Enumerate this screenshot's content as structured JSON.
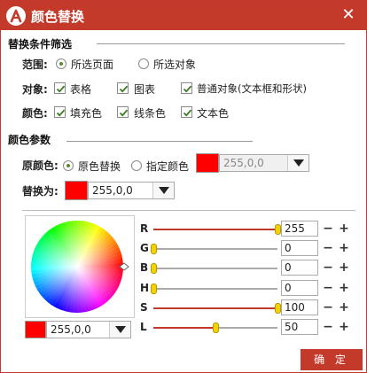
{
  "window": {
    "title": "颜色替换",
    "logo_icon": "app-logo-icon",
    "close_glyph": "✕"
  },
  "filter": {
    "title": "替换条件筛选",
    "scope_label": "范围:",
    "scope_options": [
      {
        "label": "所选页面",
        "selected": true
      },
      {
        "label": "所选对象",
        "selected": false
      }
    ],
    "object_label": "对象:",
    "object_options": [
      {
        "label": "表格",
        "checked": true
      },
      {
        "label": "图表",
        "checked": true
      },
      {
        "label": "普通对象(文本框和形状)",
        "checked": true
      }
    ],
    "color_label": "颜色:",
    "color_options": [
      {
        "label": "填充色",
        "checked": true
      },
      {
        "label": "线条色",
        "checked": true
      },
      {
        "label": "文本色",
        "checked": true
      }
    ]
  },
  "params": {
    "title": "颜色参数",
    "original_label": "原颜色:",
    "original_options": [
      {
        "label": "原色替换",
        "selected": true
      },
      {
        "label": "指定颜色",
        "selected": false
      }
    ],
    "original_value": "255,0,0",
    "replace_label": "替换为:",
    "replace_value": "255,0,0"
  },
  "picker": {
    "current_value": "255,0,0",
    "sliders": [
      {
        "label": "R",
        "value": "255",
        "fraction": 1.0
      },
      {
        "label": "G",
        "value": "0",
        "fraction": 0.0
      },
      {
        "label": "B",
        "value": "0",
        "fraction": 0.0
      },
      {
        "label": "H",
        "value": "0",
        "fraction": 0.0
      },
      {
        "label": "S",
        "value": "100",
        "fraction": 1.0
      },
      {
        "label": "L",
        "value": "50",
        "fraction": 0.5
      }
    ],
    "minus_glyph": "−",
    "plus_glyph": "+"
  },
  "footer": {
    "ok_label": "确 定"
  },
  "colors": {
    "accent": "#c43a2a",
    "selected_color": "#ff0000",
    "thumb": "#f5d000"
  }
}
